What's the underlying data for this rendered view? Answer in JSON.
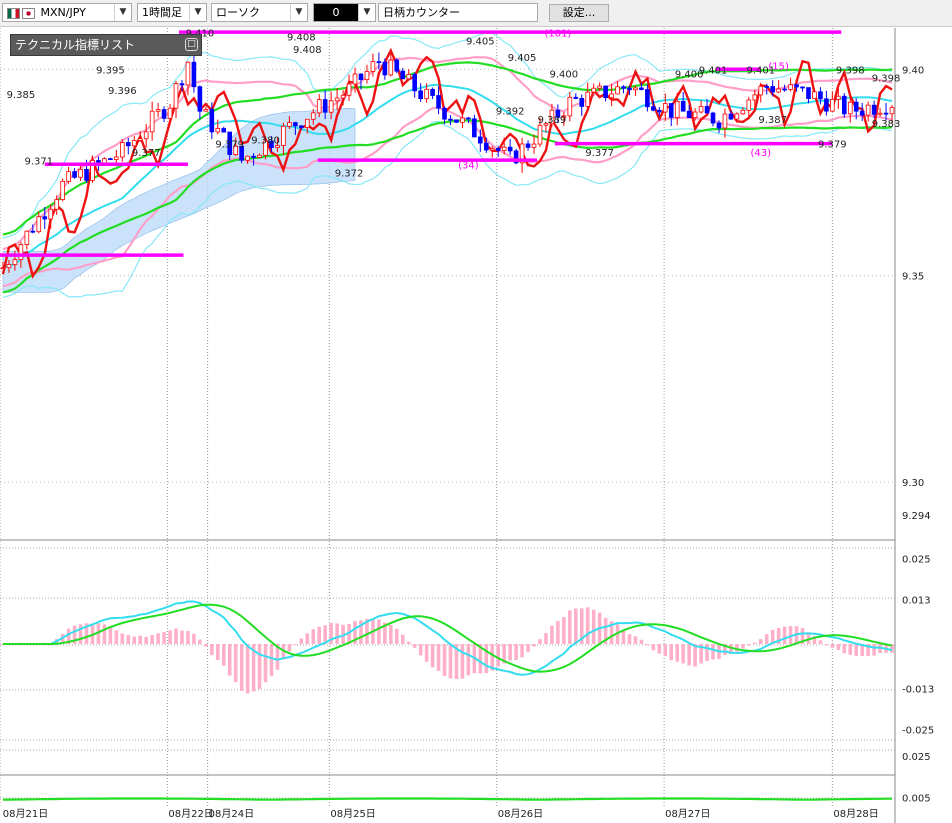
{
  "toolbar": {
    "pair": "MXN/JPY",
    "timeframe": "1時間足",
    "chart_style": "ローソク",
    "count_value": "0",
    "counter_label": "日柄カウンター",
    "settings_label": "設定..."
  },
  "indicator_panel": {
    "title": "テクニカル指標リスト",
    "minimize_glyph": "□"
  },
  "colors": {
    "bull_candle": "#ff0000",
    "bear_candle": "#0000ff",
    "cloud": "#b8d8f8",
    "bollinger_outer": "#87e8f8",
    "bollinger_inner": "#ff9fc8",
    "moving_average": "#22dd22",
    "short_average": "#33ddee",
    "oscillator": "#ee1111",
    "level_line": "#ff00ff",
    "macd_hist": "#ffb0c8"
  },
  "chart_data": [
    {
      "type": "candlestick",
      "ylim": [
        9.286,
        9.41
      ],
      "y_ticks": [
        "9.40",
        "9.35",
        "9.30",
        "9.294"
      ],
      "x_ticks": [
        "08月21日",
        "08月22日",
        "08月24日",
        "08月25日",
        "08月26日",
        "08月27日",
        "08月28日"
      ],
      "price_labels": [
        "9.385",
        "9.395",
        "9.396",
        "9.371",
        "9.377",
        "9.410",
        "9.408",
        "9.408",
        "9.379",
        "9.380",
        "9.372",
        "9.405",
        "9.405",
        "9.400",
        "9.392",
        "9.389",
        "9.377",
        "9.400",
        "9.401",
        "9.401",
        "9.387",
        "9.379",
        "9.398",
        "9.398",
        "9.383"
      ],
      "count_labels": [
        "(101)",
        "(34)",
        "(15)",
        "(43)"
      ],
      "level_lines": [
        {
          "from": 0.0,
          "to": 0.205,
          "price": 9.355
        },
        {
          "from": 0.05,
          "to": 0.21,
          "price": 9.377
        },
        {
          "from": 0.2,
          "to": 0.94,
          "price": 9.409
        },
        {
          "from": 0.355,
          "to": 0.6,
          "price": 9.378
        },
        {
          "from": 0.62,
          "to": 0.93,
          "price": 9.382
        },
        {
          "from": 0.8,
          "to": 0.85,
          "price": 9.4
        }
      ]
    },
    {
      "type": "line",
      "y_ticks": [
        "0.025",
        "0.013",
        "-0.013",
        "-0.025"
      ],
      "ylim": [
        -0.028,
        0.028
      ]
    },
    {
      "type": "line",
      "y_ticks": [
        "0.025",
        "0.005"
      ],
      "ylim": [
        0.0,
        0.028
      ]
    }
  ]
}
